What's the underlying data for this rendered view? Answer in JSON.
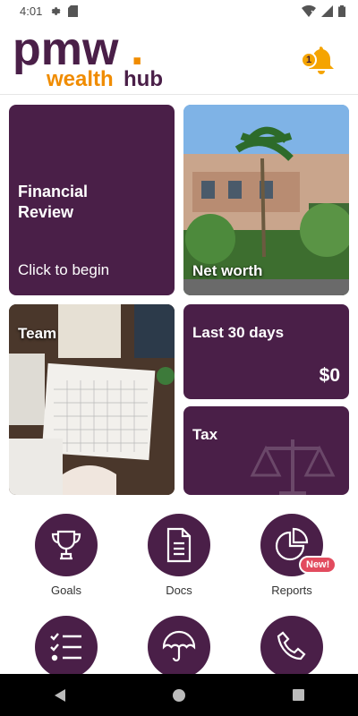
{
  "status_bar": {
    "time": "4:01",
    "icons": [
      "settings-icon",
      "sd-card-icon",
      "wifi-off-icon",
      "signal-icon",
      "battery-icon"
    ]
  },
  "header": {
    "logo_primary": "pmw",
    "logo_dot": ".",
    "logo_secondary_a": "wealth",
    "logo_secondary_b": "hub",
    "notification_count": "1"
  },
  "tiles": {
    "financial_review": {
      "title_line1": "Financial",
      "title_line2": "Review",
      "subtitle": "Click to begin"
    },
    "net_worth": {
      "title": "Net worth"
    },
    "team": {
      "title": "Team"
    },
    "last_30_days": {
      "title": "Last 30 days",
      "value": "$0"
    },
    "tax": {
      "title": "Tax"
    }
  },
  "menu": [
    {
      "label": "Goals",
      "icon": "trophy-icon"
    },
    {
      "label": "Docs",
      "icon": "document-icon"
    },
    {
      "label": "Reports",
      "icon": "pie-chart-icon",
      "badge": "New!"
    },
    {
      "label": "",
      "icon": "checklist-icon"
    },
    {
      "label": "",
      "icon": "umbrella-icon"
    },
    {
      "label": "",
      "icon": "phone-icon"
    }
  ],
  "colors": {
    "brand_purple": "#4a1f48",
    "brand_orange": "#f08c00",
    "badge_red": "#e24b5e"
  }
}
